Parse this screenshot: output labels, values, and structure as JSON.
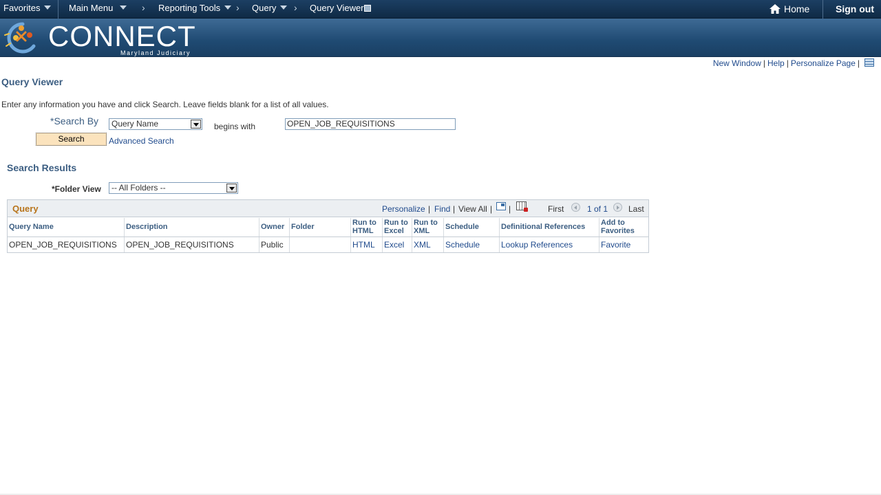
{
  "topnav": {
    "favorites": "Favorites",
    "main_menu": "Main Menu",
    "breadcrumbs": [
      "Reporting Tools",
      "Query",
      "Query Viewer"
    ],
    "home": "Home",
    "sign_out": "Sign out"
  },
  "banner": {
    "logo_text": "CONNECT",
    "logo_subtext": "Maryland Judiciary"
  },
  "page_links": {
    "new_window": "New Window",
    "help": "Help",
    "personalize_page": "Personalize Page"
  },
  "page": {
    "title": "Query Viewer",
    "instructions": "Enter any information you have and click Search. Leave fields blank for a list of all values."
  },
  "search": {
    "label": "*Search By",
    "by_value": "Query Name",
    "operator": "begins with",
    "value": "OPEN_JOB_REQUISITIONS",
    "button": "Search",
    "advanced": "Advanced Search"
  },
  "results": {
    "title": "Search Results",
    "folder_label": "*Folder View",
    "folder_value": "-- All Folders --"
  },
  "grid": {
    "title": "Query",
    "personalize": "Personalize",
    "find": "Find",
    "view_all": "View All",
    "first": "First",
    "range": "1 of 1",
    "last": "Last",
    "columns": {
      "query_name": "Query Name",
      "description": "Description",
      "owner": "Owner",
      "folder": "Folder",
      "run_html_1": "Run to",
      "run_html_2": "HTML",
      "run_excel_1": "Run to",
      "run_excel_2": "Excel",
      "run_xml_1": "Run to",
      "run_xml_2": "XML",
      "schedule": "Schedule",
      "definitional_references": "Definitional References",
      "add_fav_1": "Add to",
      "add_fav_2": "Favorites"
    },
    "rows": [
      {
        "query_name": "OPEN_JOB_REQUISITIONS",
        "description": "OPEN_JOB_REQUISITIONS",
        "owner": "Public",
        "folder": "",
        "run_html": "HTML",
        "run_excel": "Excel",
        "run_xml": "XML",
        "schedule": "Schedule",
        "references": "Lookup References",
        "favorite": "Favorite"
      }
    ]
  },
  "colors": {
    "nav_bg": "#1c3f63",
    "banner_bg": "#2b5781",
    "link": "#1f4a8c",
    "heading": "#3c5e82",
    "grid_title": "#b8741a",
    "button_bg": "#fbe3bd"
  }
}
